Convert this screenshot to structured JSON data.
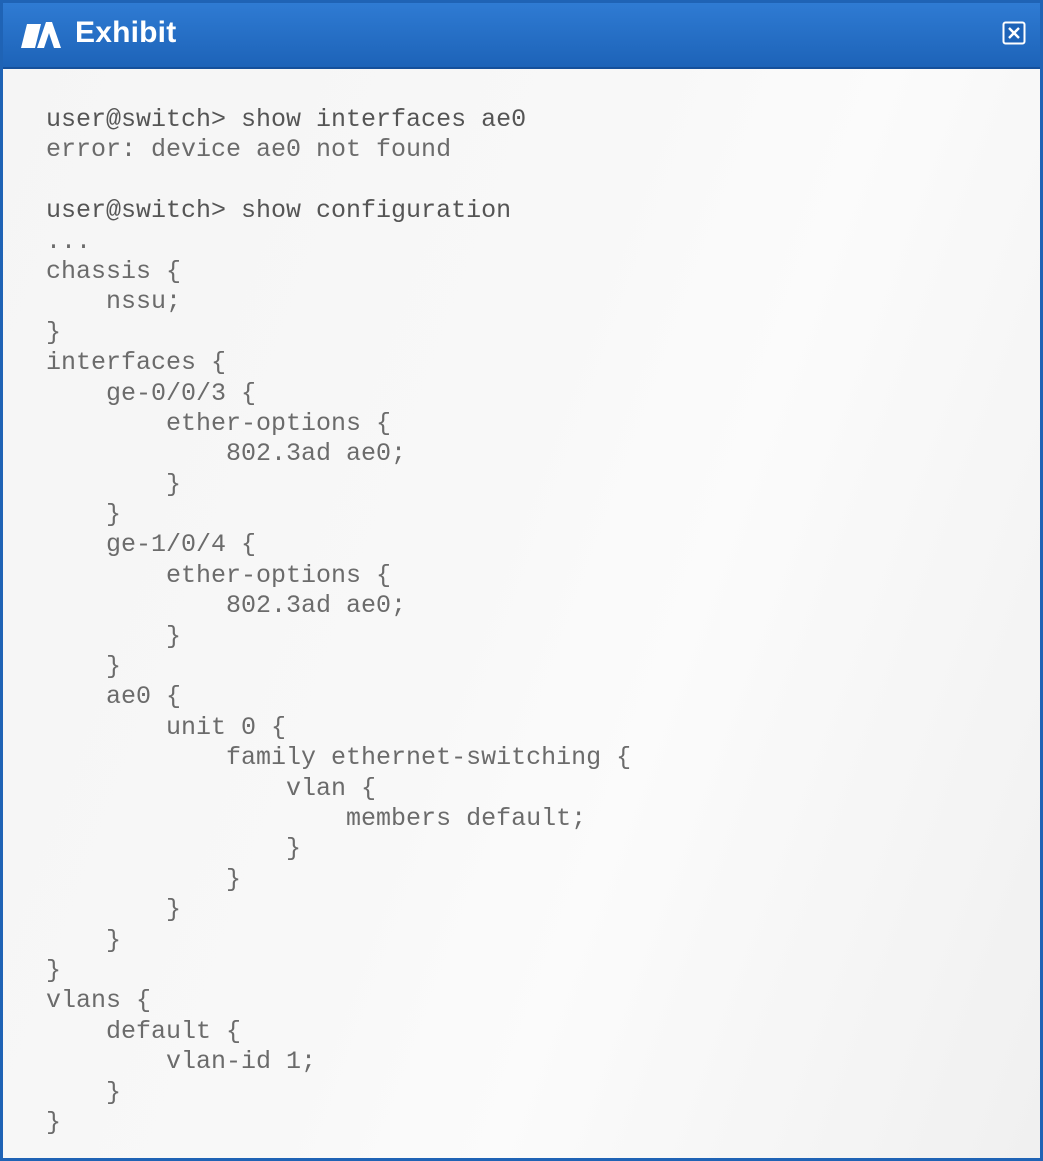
{
  "window": {
    "title": "Exhibit",
    "app_icon": "exhibit-icon",
    "close_icon": "close-icon",
    "accent_color": "#1f63b5"
  },
  "terminal": {
    "lines": [
      "user@switch> show interfaces ae0",
      "error: device ae0 not found",
      "",
      "user@switch> show configuration",
      "...",
      "chassis {",
      "    nssu;",
      "}",
      "interfaces {",
      "    ge-0/0/3 {",
      "        ether-options {",
      "            802.3ad ae0;",
      "        }",
      "    }",
      "    ge-1/0/4 {",
      "        ether-options {",
      "            802.3ad ae0;",
      "        }",
      "    }",
      "    ae0 {",
      "        unit 0 {",
      "            family ethernet-switching {",
      "                vlan {",
      "                    members default;",
      "                }",
      "            }",
      "        }",
      "    }",
      "}",
      "vlans {",
      "    default {",
      "        vlan-id 1;",
      "    }",
      "}"
    ]
  }
}
